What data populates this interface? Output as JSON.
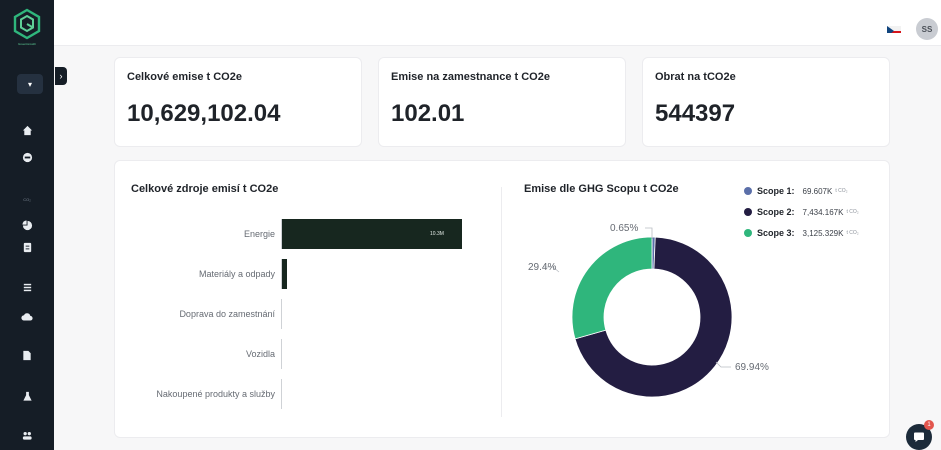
{
  "brand": {
    "logo_caption": "GreenGrowth",
    "colors": {
      "sidebar": "#151d26",
      "accent": "#2fb67c",
      "bar": "#17271f",
      "scope2": "#231d42",
      "scope1": "#5b6fa9"
    }
  },
  "sidebar": {
    "workspace_toggle_icon": "chevron-down-icon",
    "collapse_icon": "chevron-right-icon",
    "items": [
      {
        "icon": "home-icon"
      },
      {
        "icon": "account-circle-icon"
      },
      {
        "tiny_label": "CO₂"
      },
      {
        "icon": "pie-chart-icon"
      },
      {
        "icon": "document-icon"
      },
      {
        "icon": "list-icon"
      },
      {
        "icon": "cloud-icon"
      },
      {
        "icon": "file-icon"
      },
      {
        "icon": "flask-icon"
      },
      {
        "icon": "team-icon"
      }
    ]
  },
  "topbar": {
    "language_flag": "flag-cz-icon",
    "user_initials": "SS"
  },
  "kpis": [
    {
      "title": "Celkové emise t CO2e",
      "value": "10,629,102.04"
    },
    {
      "title": "Emise na zamestnance t CO2e",
      "value": "102.01"
    },
    {
      "title": "Obrat na tCO2e",
      "value": "544397"
    }
  ],
  "sources_chart": {
    "title": "Celkové zdroje emisí t CO2e",
    "chart_data": {
      "type": "bar",
      "orientation": "horizontal",
      "categories": [
        "Energie",
        "Materiály a odpady",
        "Doprava do zamestnání",
        "Vozidla",
        "Nakoupené produkty a služby"
      ],
      "values": [
        10.3,
        0.3,
        0.01,
        0.01,
        0.01
      ],
      "unit": "M t CO2e",
      "data_labels": [
        "10.3M",
        "",
        "",
        "",
        ""
      ],
      "xlim": [
        0,
        10.3
      ]
    }
  },
  "scope_chart": {
    "title": "Emise dle GHG Scopu t CO2e",
    "chart_data": {
      "type": "pie",
      "style": "donut",
      "legend_position": "right",
      "series": [
        {
          "name": "Scope 1:",
          "value": "69.607K",
          "unit": "t CO₂",
          "percent": 0.65,
          "percent_label": "0.65%",
          "color": "#5b6fa9"
        },
        {
          "name": "Scope 2:",
          "value": "7,434.167K",
          "unit": "t CO₂",
          "percent": 69.94,
          "percent_label": "69.94%",
          "color": "#231d42"
        },
        {
          "name": "Scope 3:",
          "value": "3,125.329K",
          "unit": "t CO₂",
          "percent": 29.4,
          "percent_label": "29.4%",
          "color": "#2fb67c"
        }
      ]
    }
  },
  "chat": {
    "icon": "chat-bubble-icon",
    "badge": "1"
  }
}
